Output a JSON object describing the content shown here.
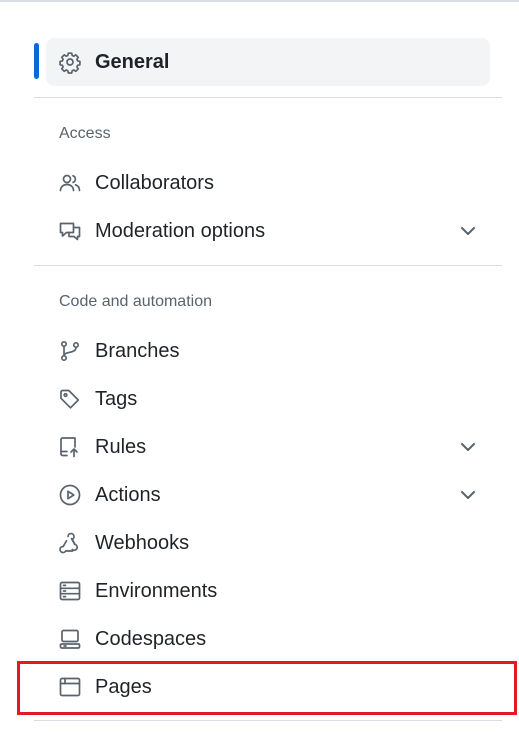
{
  "sidebar": {
    "general": {
      "label": "General",
      "icon": "gear-icon",
      "active": true
    },
    "sections": [
      {
        "heading": "Access",
        "items": [
          {
            "label": "Collaborators",
            "icon": "people-icon",
            "expandable": false
          },
          {
            "label": "Moderation options",
            "icon": "comment-discussion-icon",
            "expandable": true
          }
        ]
      },
      {
        "heading": "Code and automation",
        "items": [
          {
            "label": "Branches",
            "icon": "git-branch-icon",
            "expandable": false
          },
          {
            "label": "Tags",
            "icon": "tag-icon",
            "expandable": false
          },
          {
            "label": "Rules",
            "icon": "repo-push-icon",
            "expandable": true
          },
          {
            "label": "Actions",
            "icon": "play-icon",
            "expandable": true
          },
          {
            "label": "Webhooks",
            "icon": "webhook-icon",
            "expandable": false
          },
          {
            "label": "Environments",
            "icon": "server-icon",
            "expandable": false
          },
          {
            "label": "Codespaces",
            "icon": "codespaces-icon",
            "expandable": false
          },
          {
            "label": "Pages",
            "icon": "browser-icon",
            "expandable": false,
            "highlighted": true
          }
        ]
      }
    ]
  },
  "colors": {
    "active_indicator": "#0969da",
    "highlight_border": "#e01b24",
    "text": "#1f2328",
    "muted": "#59636e"
  }
}
